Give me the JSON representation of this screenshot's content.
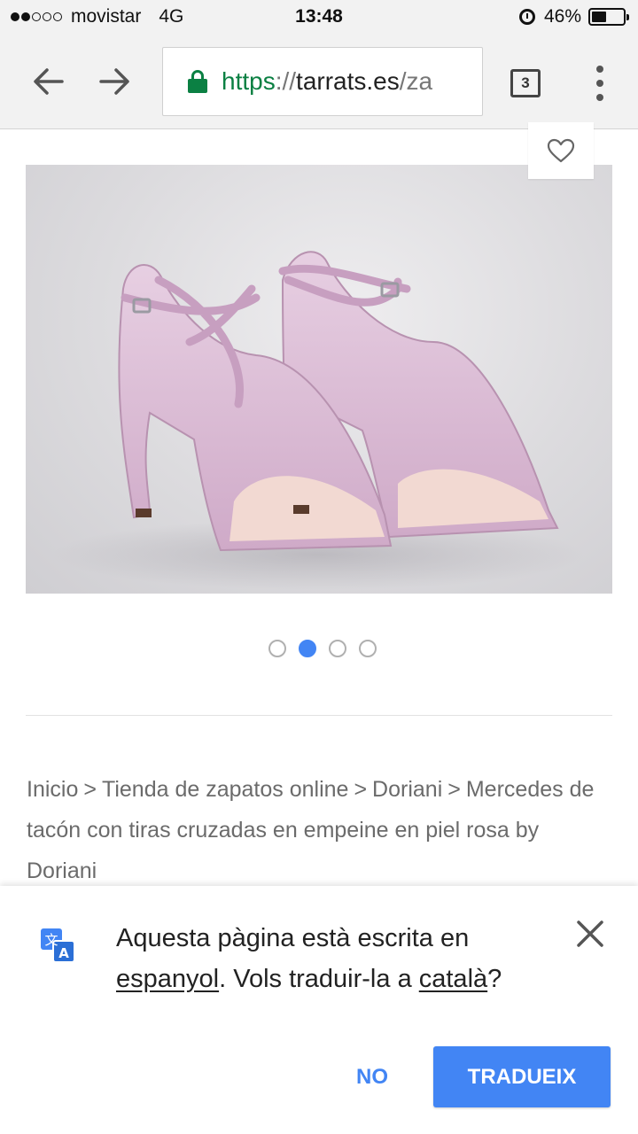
{
  "status_bar": {
    "carrier": "movistar",
    "network": "4G",
    "time": "13:48",
    "battery": "46%",
    "battery_level": 0.46,
    "signal_bars_filled": 2,
    "signal_bars_total": 5
  },
  "browser": {
    "url_scheme": "https",
    "url_separator": "://",
    "url_host": "tarrats.es",
    "url_path": "/za",
    "tab_count": "3"
  },
  "product": {
    "carousel_total": 4,
    "carousel_active_index": 1
  },
  "breadcrumb": {
    "items": [
      "Inicio",
      "Tienda de zapatos online",
      "Doriani",
      "Mercedes de tacón con tiras cruzadas en empeine en piel rosa by Doriani"
    ],
    "separator": ">"
  },
  "translate_bar": {
    "message_part1": "Aquesta pàgina està escrita en",
    "source_language": "espanyol",
    "message_part2": ". Vols traduir-la a ",
    "target_language": "català",
    "message_part3": "?",
    "no_label": "NO",
    "translate_label": "TRADUEIX"
  },
  "colors": {
    "accent": "#4285f4",
    "secure_green": "#0b8043",
    "shoe_pink": "#dcbdd7"
  }
}
